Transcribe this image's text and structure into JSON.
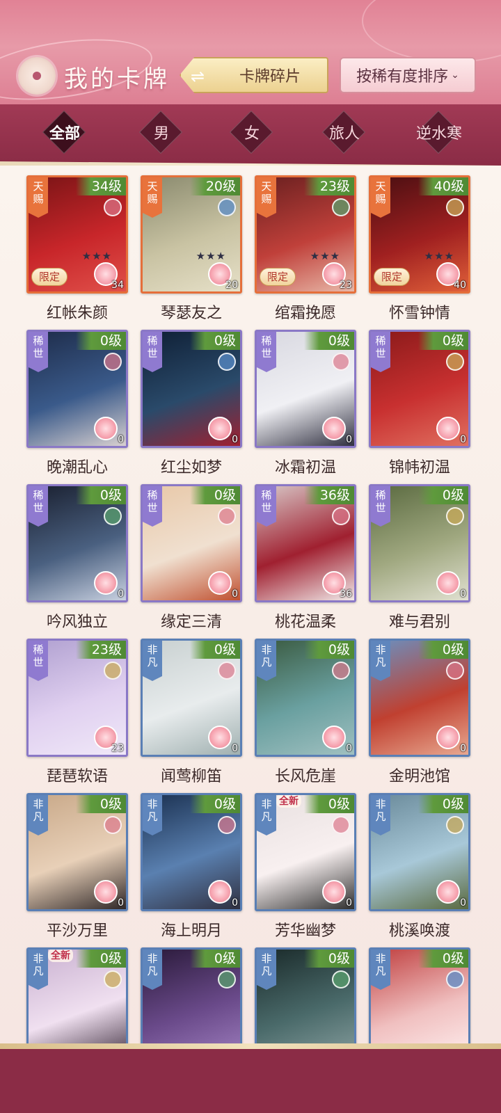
{
  "header": {
    "title": "我的卡牌",
    "shards_label": "卡牌碎片",
    "swap_icon": "⇌",
    "sort_label": "按稀有度排序",
    "sort_chevron": "⌄"
  },
  "filters": [
    {
      "label": "全部",
      "active": true
    },
    {
      "label": "男",
      "active": false
    },
    {
      "label": "女",
      "active": false
    },
    {
      "label": "旅人",
      "active": false
    },
    {
      "label": "逆水寒",
      "active": false
    }
  ],
  "rarity_labels": {
    "tianci": "天赐",
    "xishi": "稀世",
    "feifan": "非凡"
  },
  "badges": {
    "limited": "限定",
    "new": "全新"
  },
  "cards": [
    {
      "name": "红帐朱颜",
      "level": "34级",
      "rarity": "tianci",
      "count": "34",
      "limited": true,
      "stars": "★★★",
      "art": [
        "#7a1416",
        "#c8262a",
        "#e0504a"
      ],
      "emblem": "pink"
    },
    {
      "name": "琴瑟友之",
      "level": "20级",
      "rarity": "tianci",
      "count": "20",
      "limited": false,
      "stars": "★★★",
      "art": [
        "#8a8a6e",
        "#c9c3a3",
        "#e6e0c8"
      ],
      "emblem": "blue"
    },
    {
      "name": "绾霜挽愿",
      "level": "23级",
      "rarity": "tianci",
      "count": "23",
      "limited": true,
      "stars": "★★★",
      "art": [
        "#6a2020",
        "#c0403a",
        "#e8b8a8"
      ],
      "emblem": "green"
    },
    {
      "name": "怀雪钟情",
      "level": "40级",
      "rarity": "tianci",
      "count": "40",
      "limited": true,
      "stars": "★★★",
      "art": [
        "#4a0f12",
        "#a02020",
        "#e0603a"
      ],
      "emblem": "gold"
    },
    {
      "name": "晚潮乱心",
      "level": "0级",
      "rarity": "xishi",
      "count": "0",
      "limited": false,
      "stars": "",
      "art": [
        "#1e2c4a",
        "#3a5a8a",
        "#d8d0d0"
      ],
      "emblem": "pink"
    },
    {
      "name": "红尘如梦",
      "level": "0级",
      "rarity": "xishi",
      "count": "0",
      "limited": false,
      "stars": "",
      "art": [
        "#0f1f35",
        "#2a4a6a",
        "#a02030"
      ],
      "emblem": "blue"
    },
    {
      "name": "冰霜初温",
      "level": "0级",
      "rarity": "xishi",
      "count": "0",
      "limited": false,
      "stars": "",
      "art": [
        "#d8d8e0",
        "#f0f0f4",
        "#303040"
      ],
      "emblem": "pink"
    },
    {
      "name": "锦帏初温",
      "level": "0级",
      "rarity": "xishi",
      "count": "0",
      "limited": false,
      "stars": "",
      "art": [
        "#8a1a1a",
        "#c83030",
        "#e07060"
      ],
      "emblem": "gold"
    },
    {
      "name": "吟风独立",
      "level": "0级",
      "rarity": "xishi",
      "count": "0",
      "limited": false,
      "stars": "",
      "art": [
        "#1a2030",
        "#4a6080",
        "#c8d0e0"
      ],
      "emblem": "green"
    },
    {
      "name": "缘定三清",
      "level": "0级",
      "rarity": "xishi",
      "count": "0",
      "limited": false,
      "stars": "",
      "art": [
        "#e8c8a8",
        "#f0e0d0",
        "#c05030"
      ],
      "emblem": "pink"
    },
    {
      "name": "桃花温柔",
      "level": "36级",
      "rarity": "xishi",
      "count": "36",
      "limited": false,
      "stars": "",
      "art": [
        "#d8c8c8",
        "#a02030",
        "#f0e8e8"
      ],
      "emblem": "pink"
    },
    {
      "name": "难与君别",
      "level": "0级",
      "rarity": "xishi",
      "count": "0",
      "limited": false,
      "stars": "",
      "art": [
        "#5a6a40",
        "#a0a880",
        "#e0e0d0"
      ],
      "emblem": "gold"
    },
    {
      "name": "琵琶软语",
      "level": "23级",
      "rarity": "xishi",
      "count": "23",
      "limited": false,
      "stars": "",
      "art": [
        "#b0a0d0",
        "#e0d0f0",
        "#f0e8f8"
      ],
      "emblem": "gold"
    },
    {
      "name": "闻莺柳笛",
      "level": "0级",
      "rarity": "feifan",
      "count": "0",
      "limited": false,
      "stars": "",
      "art": [
        "#c8d0d0",
        "#e8eced",
        "#a0b0b0"
      ],
      "emblem": "pink"
    },
    {
      "name": "长风危崖",
      "level": "0级",
      "rarity": "feifan",
      "count": "0",
      "limited": false,
      "stars": "",
      "art": [
        "#3a5a40",
        "#6aa0a0",
        "#a0c0c0"
      ],
      "emblem": "pink"
    },
    {
      "name": "金明池馆",
      "level": "0级",
      "rarity": "feifan",
      "count": "0",
      "limited": false,
      "stars": "",
      "art": [
        "#6a90c0",
        "#c04030",
        "#e8a890"
      ],
      "emblem": "pink"
    },
    {
      "name": "平沙万里",
      "level": "0级",
      "rarity": "feifan",
      "count": "0",
      "limited": false,
      "stars": "",
      "art": [
        "#c8a888",
        "#e8d0b8",
        "#302828"
      ],
      "emblem": "pink"
    },
    {
      "name": "海上明月",
      "level": "0级",
      "rarity": "feifan",
      "count": "0",
      "limited": false,
      "stars": "",
      "art": [
        "#1a3050",
        "#5a80b0",
        "#303040"
      ],
      "emblem": "pink"
    },
    {
      "name": "芳华幽梦",
      "level": "0级",
      "rarity": "feifan",
      "count": "0",
      "limited": false,
      "new": true,
      "stars": "",
      "art": [
        "#e8e0e0",
        "#f8f0f0",
        "#303030"
      ],
      "emblem": "pink"
    },
    {
      "name": "桃溪唤渡",
      "level": "0级",
      "rarity": "feifan",
      "count": "0",
      "limited": false,
      "stars": "",
      "art": [
        "#6a8a9a",
        "#a8c8d8",
        "#5a6a40"
      ],
      "emblem": "gold"
    },
    {
      "name": "",
      "level": "0级",
      "rarity": "feifan",
      "count": "",
      "limited": false,
      "new": true,
      "stars": "",
      "art": [
        "#c8b0d0",
        "#f0e0f0",
        "#3a2a3a"
      ],
      "emblem": "gold"
    },
    {
      "name": "",
      "level": "0级",
      "rarity": "feifan",
      "count": "",
      "limited": false,
      "stars": "",
      "art": [
        "#2a1a3a",
        "#6a4a8a",
        "#a080c0"
      ],
      "emblem": "green"
    },
    {
      "name": "",
      "level": "0级",
      "rarity": "feifan",
      "count": "",
      "limited": false,
      "stars": "",
      "art": [
        "#1a2a2a",
        "#4a6a6a",
        "#8aa0a0"
      ],
      "emblem": "green"
    },
    {
      "name": "",
      "level": "0级",
      "rarity": "feifan",
      "count": "",
      "limited": false,
      "stars": "",
      "art": [
        "#c04040",
        "#f0c0c0",
        "#fff0f0"
      ],
      "emblem": "blue"
    }
  ]
}
